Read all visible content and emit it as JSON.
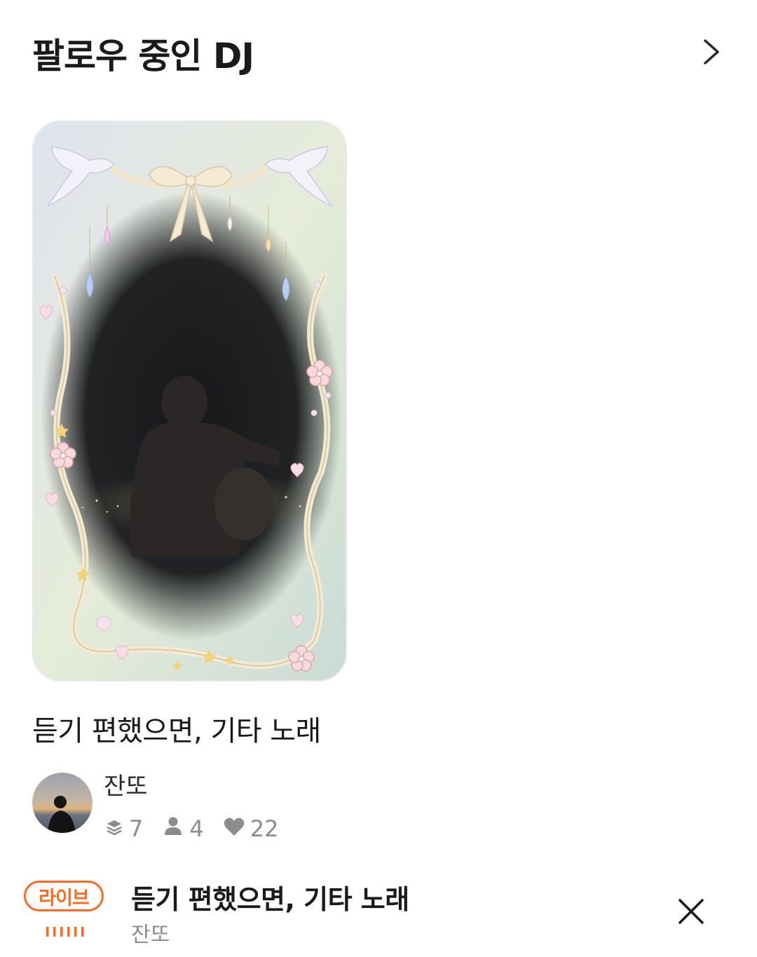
{
  "header": {
    "title": "팔로우 중인 DJ"
  },
  "card": {
    "title": "듣기 편했으면, 기타 노래",
    "dj_name": "잔또",
    "stats": {
      "layers": "7",
      "listeners": "4",
      "likes": "22"
    }
  },
  "mini_player": {
    "badge": "라이브",
    "title": "듣기 편했으면, 기타 노래",
    "subtitle": "잔또"
  },
  "colors": {
    "accent": "#ff6a22",
    "text": "#1a1a1a",
    "muted": "#8c8c8c"
  },
  "icons": [
    "chevron-right-icon",
    "layers-icon",
    "person-icon",
    "heart-icon",
    "equalizer-icon",
    "close-icon"
  ]
}
